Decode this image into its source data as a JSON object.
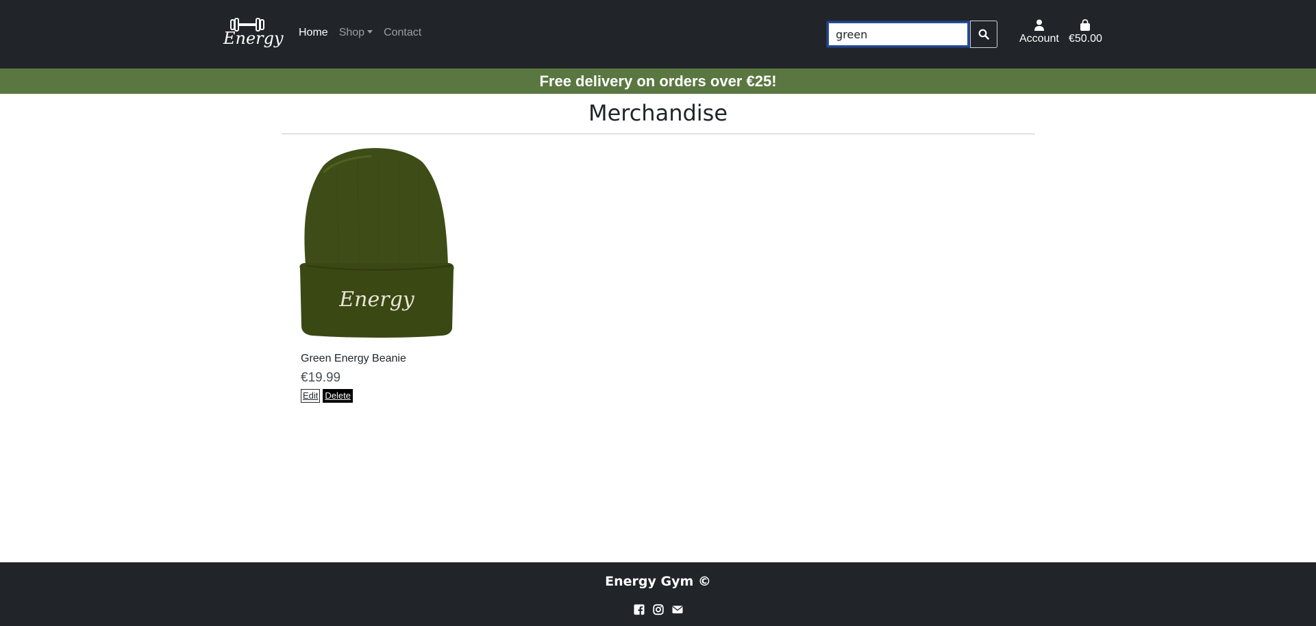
{
  "brand": {
    "logo_text": "Energy",
    "logo_icon": "dumbbell-icon"
  },
  "nav": {
    "links": [
      {
        "label": "Home",
        "active": true
      },
      {
        "label": "Shop",
        "dropdown": true
      },
      {
        "label": "Contact"
      }
    ]
  },
  "search": {
    "value": "green",
    "button_icon": "search-icon"
  },
  "account": {
    "label": "Account",
    "icon": "user-icon"
  },
  "cart": {
    "total": "€50.00",
    "icon": "shopping-bag-icon"
  },
  "banner": {
    "text": "Free delivery on orders over €25!"
  },
  "page": {
    "heading": "Merchandise"
  },
  "products": [
    {
      "name": "Green Energy Beanie",
      "price": "€19.99",
      "image_text": "Energy",
      "edit_label": "Edit",
      "delete_label": "Delete"
    }
  ],
  "footer": {
    "title": "Energy Gym ©",
    "icons": [
      "facebook-icon",
      "instagram-icon",
      "envelope-icon"
    ]
  },
  "colors": {
    "navbar": "#212529",
    "banner": "#5a7741",
    "beanie": "#3e4d17"
  }
}
